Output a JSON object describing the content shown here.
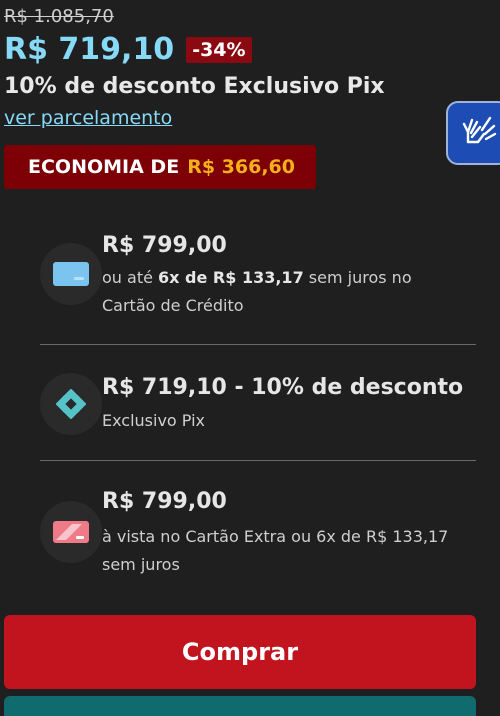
{
  "pricing": {
    "old_price": "R$ 1.085,70",
    "price": "R$ 719,10",
    "discount_badge": "-34%",
    "pix_discount_text": "10% de desconto Exclusivo Pix",
    "installments_link": "ver parcelamento",
    "economy_label": "ECONOMIA DE",
    "economy_value": "R$ 366,60"
  },
  "payment_options": [
    {
      "icon": "credit-card-icon",
      "title": "R$ 799,00",
      "desc_prefix": "ou até",
      "desc_bold": "6x de R$ 133,17",
      "desc_suffix": "sem juros no",
      "desc_line2": "Cartão de Crédito"
    },
    {
      "icon": "pix-icon",
      "title": "R$ 719,10 - 10% de desconto",
      "desc": "Exclusivo Pix"
    },
    {
      "icon": "store-card-icon",
      "title": "R$ 799,00",
      "desc_line1": "à vista no Cartão Extra ou 6x de R$ 133,17",
      "desc_line2": "sem juros"
    }
  ],
  "actions": {
    "buy_label": "Comprar"
  },
  "accessibility": {
    "icon": "sign-language-icon"
  },
  "colors": {
    "background": "#1f1f1f",
    "price": "#86d9f7",
    "badge": "#8b0a12",
    "economy_bg": "#7d0006",
    "economy_value": "#f4b01a",
    "buy_button": "#c2141f",
    "accessibility_bg": "#1d4db4"
  }
}
